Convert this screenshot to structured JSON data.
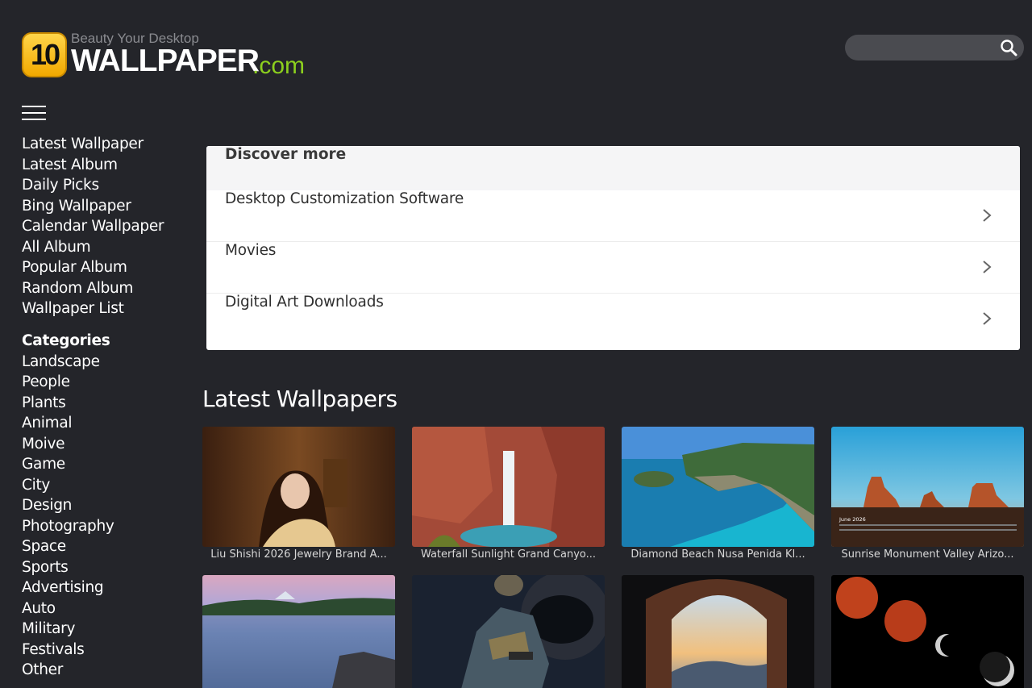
{
  "logo": {
    "badge": "10",
    "tagline": "Beauty Your Desktop",
    "name": "WALLPAPER",
    "tld": ".com",
    "colors": {
      "badge": "#f2a900",
      "tld": "#8ccf1e"
    }
  },
  "search": {
    "placeholder": "",
    "value": ""
  },
  "sidebar": {
    "links": [
      "Latest Wallpaper",
      "Latest Album",
      "Daily Picks",
      "Bing Wallpaper",
      "Calendar Wallpaper",
      "All Album",
      "Popular Album",
      "Random Album",
      "Wallpaper List"
    ],
    "categories_heading": "Categories",
    "categories": [
      "Landscape",
      "People",
      "Plants",
      "Animal",
      "Moive",
      "Game",
      "City",
      "Design",
      "Photography",
      "Space",
      "Sports",
      "Advertising",
      "Auto",
      "Military",
      "Festivals",
      "Other"
    ]
  },
  "discover": {
    "heading": "Discover more",
    "items": [
      "Desktop Customization Software",
      "Movies",
      "Digital Art Downloads"
    ]
  },
  "latest": {
    "title": "Latest Wallpapers",
    "row1": [
      "Liu Shishi 2026 Jewelry Brand A...",
      "Waterfall Sunlight Grand Canyo...",
      "Diamond Beach Nusa Penida Kl...",
      "Sunrise Monument Valley Arizo..."
    ],
    "calendar_label": "June 2026"
  },
  "colors": {
    "background": "#24252a",
    "card": "#ffffff"
  }
}
